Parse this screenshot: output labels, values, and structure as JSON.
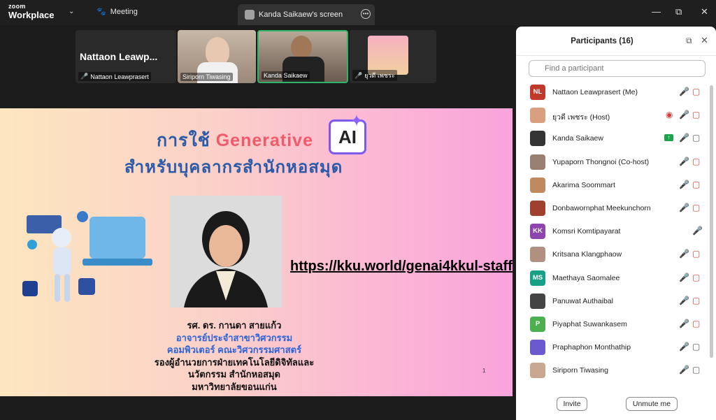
{
  "app": {
    "logo_top": "zoom",
    "logo_bottom": "Workplace",
    "meeting_tab": "Meeting",
    "screen_tab": "Kanda Saikaew's screen",
    "icons": [
      "chevron-down-icon",
      "paw-icon",
      "more-icon",
      "minimize-icon",
      "restore-icon",
      "close-icon"
    ]
  },
  "video_strip": {
    "tiles": [
      {
        "display_name": "Nattaon  Leawp...",
        "label": "Nattaon Leawprasert",
        "muted": true,
        "video": false
      },
      {
        "label": "Siriporn Tiwasing",
        "muted": false,
        "video": true
      },
      {
        "label": "Kanda Saikaew",
        "muted": false,
        "video": true,
        "active_speaker": true
      },
      {
        "label": "ยุวดี เพชระ",
        "muted": true,
        "video": true
      }
    ]
  },
  "slide": {
    "title_prefix": "การใช้",
    "title_highlight": "Generative",
    "title_ai": "AI",
    "subtitle": "สำหรับบุคลากรสำนักหอสมุด",
    "link": "https://kku.world/genai4kkul-staff",
    "credit_lines": [
      "รศ. ดร. กานดา สายแก้ว",
      "อาจารย์ประจำสาขาวิศวกรรม",
      "คอมพิวเตอร์ คณะวิศวกรรมศาสตร์",
      "รองผู้อำนวยการฝ่ายเทคโนโลยีดิจิทัลและ",
      "นวัตกรรม สำนักหอสมุด",
      "มหาวิทยาลัยขอนแก่น"
    ],
    "page_number": "1",
    "colors": {
      "title_blue": "#2a5aa8",
      "highlight_red": "#f05a6a",
      "credit_blue": "#2f63d8"
    }
  },
  "participants": {
    "title": "Participants (16)",
    "search_placeholder": "Find a participant",
    "list": [
      {
        "initials": "NL",
        "avatar_color": "#c0392b",
        "name": "Nattaon Leawprasert (Me)",
        "mic": "muted",
        "cam": "off"
      },
      {
        "initials": "",
        "avatar_color": "#d9a080",
        "name": "ยุวดี เพชระ (Host)",
        "mic": "muted",
        "cam": "off",
        "recording": true
      },
      {
        "initials": "",
        "avatar_color": "#333333",
        "name": "Kanda Saikaew",
        "mic": "on",
        "cam": "on",
        "sharing": true
      },
      {
        "initials": "",
        "avatar_color": "#9a8070",
        "name": "Yupaporn Thongnoi (Co-host)",
        "mic": "muted",
        "cam": "off"
      },
      {
        "initials": "",
        "avatar_color": "#c08a60",
        "name": "Akarima Soommart",
        "mic": "muted",
        "cam": "off"
      },
      {
        "initials": "",
        "avatar_color": "#a04030",
        "name": "Donbawornphat Meekunchorn",
        "mic": "muted",
        "cam": "off"
      },
      {
        "initials": "KK",
        "avatar_color": "#8e44ad",
        "name": "Komsri Komtipayarat",
        "mic": "muted",
        "cam": "none"
      },
      {
        "initials": "",
        "avatar_color": "#b09080",
        "name": "Kritsana Klangphaow",
        "mic": "muted",
        "cam": "off"
      },
      {
        "initials": "MS",
        "avatar_color": "#16a085",
        "name": "Maethaya Saomalee",
        "mic": "muted",
        "cam": "off"
      },
      {
        "initials": "",
        "avatar_color": "#444444",
        "name": "Panuwat Authaibal",
        "mic": "muted",
        "cam": "off"
      },
      {
        "initials": "P",
        "avatar_color": "#4caf50",
        "name": "Piyaphat Suwankasem",
        "mic": "muted",
        "cam": "off"
      },
      {
        "initials": "",
        "avatar_color": "#6a5acd",
        "name": "Praphaphon Monthathip",
        "mic": "muted",
        "cam": "on"
      },
      {
        "initials": "",
        "avatar_color": "#c8a890",
        "name": "Siriporn Tiwasing",
        "mic": "muted",
        "cam": "on"
      }
    ],
    "invite_label": "Invite",
    "unmute_label": "Unmute me"
  }
}
